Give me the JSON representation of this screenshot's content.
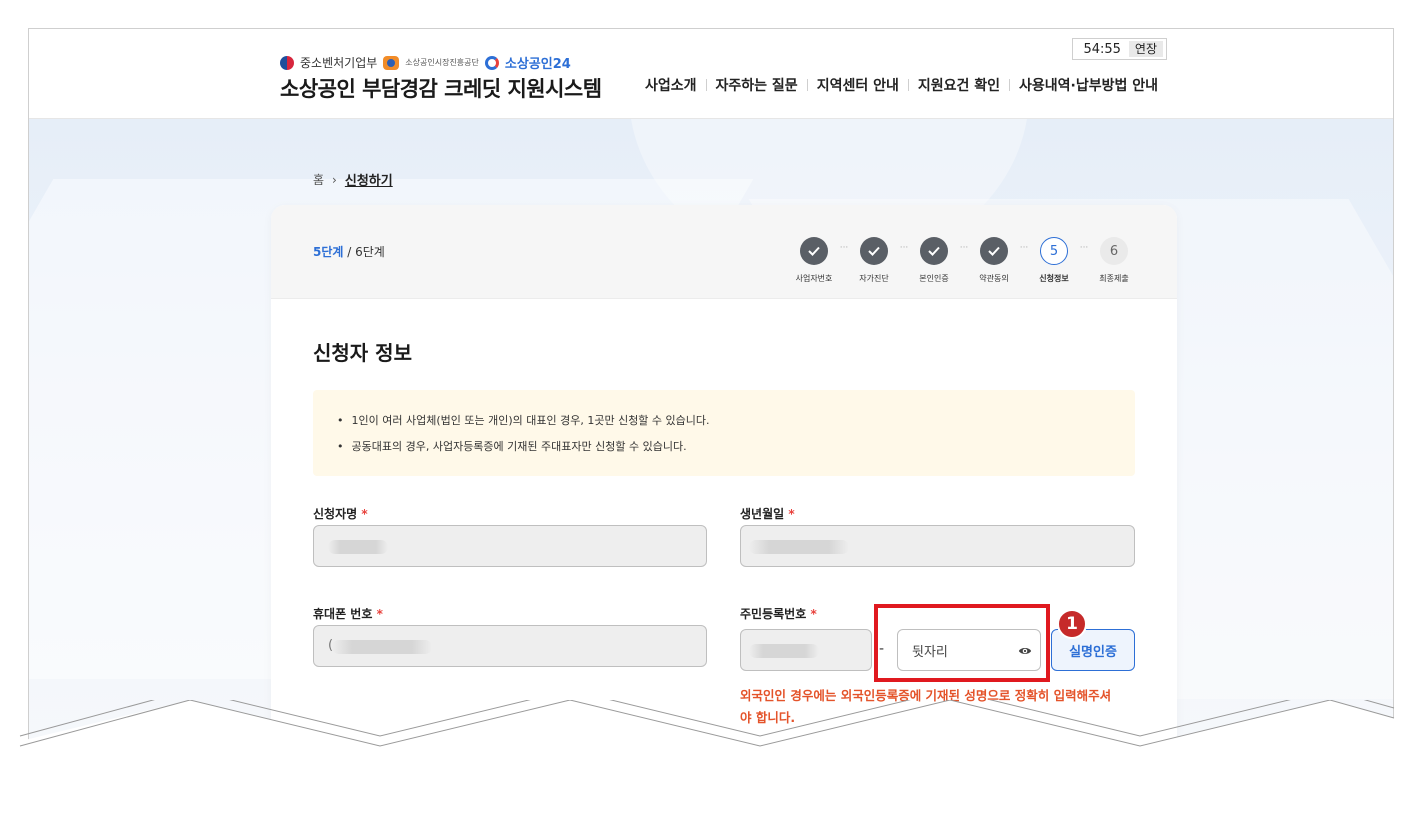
{
  "header": {
    "logos": {
      "ministry": "중소벤처기업부",
      "agency": "소상공인시장진흥공단",
      "portal_prefix": "소상공인",
      "portal_num": "24"
    },
    "site_title": "소상공인 부담경감 크레딧 지원시스템",
    "nav": [
      "사업소개",
      "자주하는 질문",
      "지역센터 안내",
      "지원요건 확인",
      "사용내역·납부방법 안내"
    ],
    "timer": "54:55",
    "extend_label": "연장"
  },
  "breadcrumb": {
    "home": "홈",
    "separator": "›",
    "current": "신청하기"
  },
  "progress": {
    "current_label": "5단계",
    "total_label": " / 6단계",
    "steps": [
      {
        "label": "사업자번호",
        "state": "done",
        "text": ""
      },
      {
        "label": "자가진단",
        "state": "done",
        "text": ""
      },
      {
        "label": "본인인증",
        "state": "done",
        "text": ""
      },
      {
        "label": "약관동의",
        "state": "done",
        "text": ""
      },
      {
        "label": "신청정보",
        "state": "active",
        "text": "5"
      },
      {
        "label": "최종제출",
        "state": "todo",
        "text": "6"
      }
    ],
    "dots": "···"
  },
  "section": {
    "title": "신청자 정보",
    "notices": [
      "1인이 여러 사업체(법인 또는 개인)의 대표인 경우, 1곳만 신청할 수 있습니다.",
      "공동대표의 경우, 사업자등록증에 기재된 주대표자만 신청할 수 있습니다."
    ]
  },
  "form": {
    "name_label": "신청자명",
    "birth_label": "생년월일",
    "phone_label": "휴대폰 번호",
    "rrn_label": "주민등록번호",
    "required_mark": "*",
    "phone_prefix": "(",
    "rrn_back_placeholder": "뒷자리",
    "rrn_dash": "-",
    "verify_label": "실명인증",
    "warning": "외국인인 경우에는 외국인등록증에 기재된 성명으로 정확히 입력해주셔야 합니다."
  },
  "annotation": {
    "badge": "1",
    "color": "#e0191f"
  },
  "colors": {
    "primary": "#2d6fd6",
    "warning": "#e4532a",
    "required": "#e8413c"
  }
}
